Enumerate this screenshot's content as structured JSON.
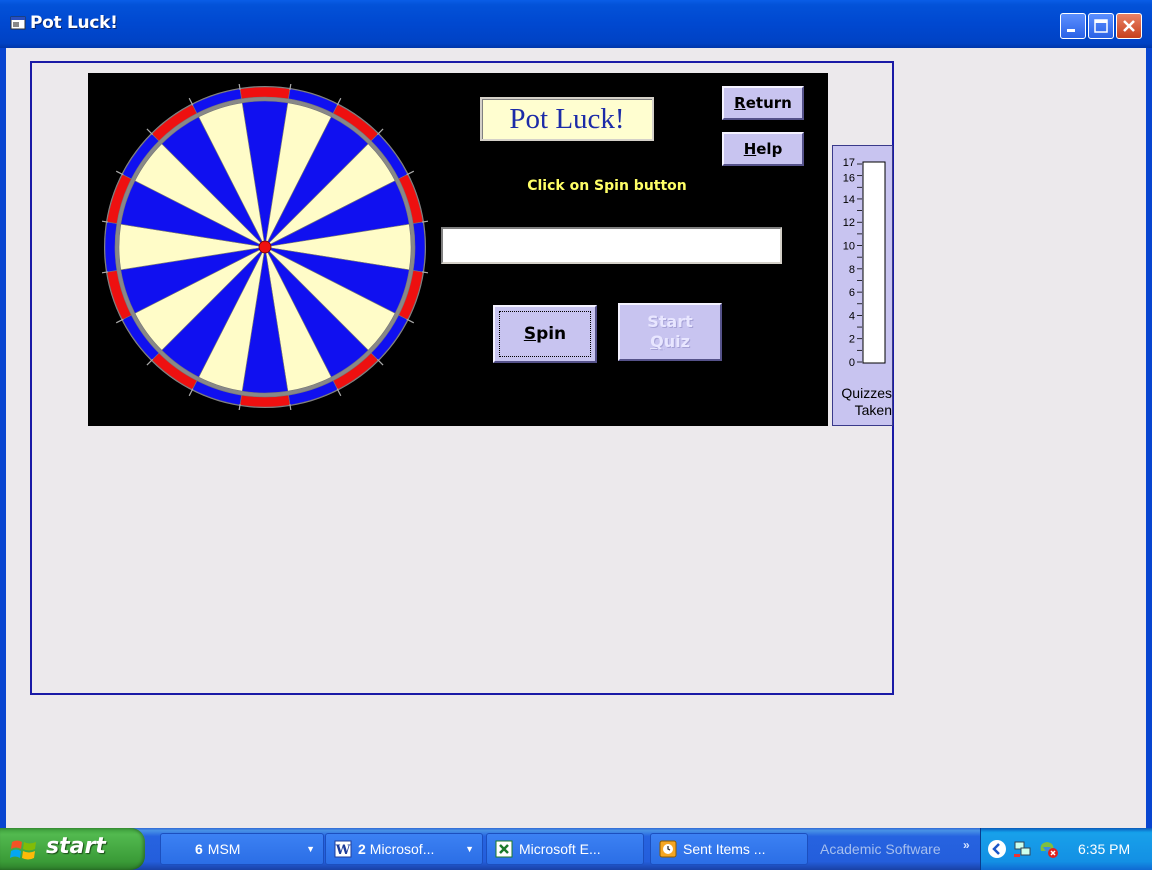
{
  "window": {
    "title": "Pot Luck!",
    "icons": {
      "app": "window-app-icon",
      "minimize": "minimize-icon",
      "maximize": "maximize-icon",
      "close": "close-icon"
    }
  },
  "game": {
    "logo_text": "Pot Luck!",
    "return_label": "Return",
    "help_label": "Help",
    "hint": "Click on Spin button",
    "result_value": "",
    "spin_label": "Spin",
    "start_quiz_line1": "Start",
    "start_quiz_line2": "Quiz",
    "dartboard_segments": 20,
    "colors": {
      "blue": "#1010f0",
      "cream": "#fffcc8",
      "red": "#ee1010",
      "panel": "#000000",
      "button": "#c8c4f0"
    }
  },
  "gauge": {
    "tick_labels": [
      "17",
      "16",
      "14",
      "12",
      "10",
      "8",
      "6",
      "4",
      "2",
      "0"
    ],
    "level": 0,
    "max": 17,
    "caption_line1": "Quizzes",
    "caption_line2": "Taken"
  },
  "taskbar": {
    "start_label": "start",
    "tasks": [
      {
        "count": "6",
        "label": "MSM",
        "icon": "group-icon"
      },
      {
        "count": "2",
        "label": "Microsof...",
        "icon": "word-icon"
      },
      {
        "count": "",
        "label": "Microsoft E...",
        "icon": "excel-icon"
      },
      {
        "count": "",
        "label": "Sent Items ...",
        "icon": "outlook-icon"
      }
    ],
    "toolbar_label": "Academic Software",
    "chevron": "»",
    "clock": "6:35 PM"
  }
}
